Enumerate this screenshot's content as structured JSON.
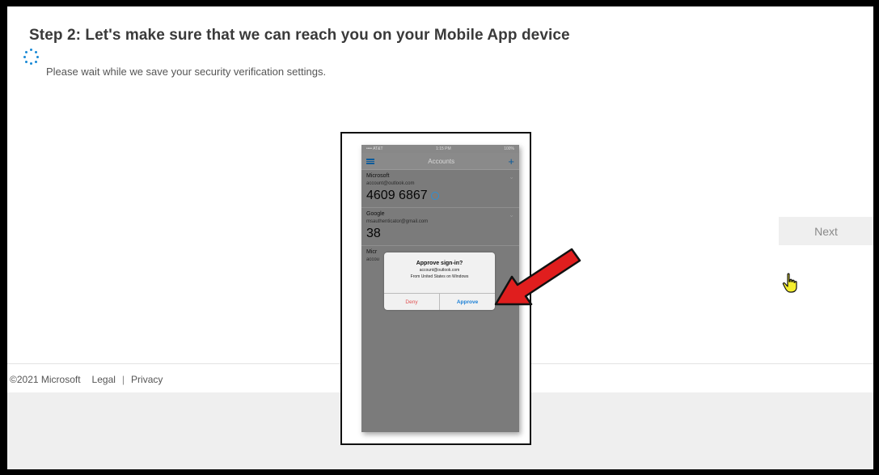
{
  "page": {
    "step_title": "Step 2: Let's make sure that we can reach you on your Mobile App device",
    "wait_text": "Please wait while we save your security verification settings.",
    "spinner_icon": "loading-spinner-icon"
  },
  "actions": {
    "next_label": "Next",
    "cursor_icon": "hand-pointer-icon"
  },
  "footer": {
    "copyright": "©2021 Microsoft",
    "legal": "Legal",
    "separator": "|",
    "privacy": "Privacy"
  },
  "phone": {
    "status_carrier": "•••• AT&T",
    "status_time": "1:15 PM",
    "status_battery": "100%",
    "header_title": "Accounts",
    "menu_icon": "hamburger-menu-icon",
    "add_icon": "plus-icon",
    "accounts": [
      {
        "name": "Microsoft",
        "email": "account@outlook.com",
        "code": "4609 6867"
      },
      {
        "name": "Google",
        "email": "msauthenticator@gmail.com",
        "code": "38"
      },
      {
        "name": "Micr",
        "email": "accou",
        "code": ""
      }
    ],
    "dialog": {
      "title": "Approve sign-in?",
      "account": "account@outlook.com",
      "location": "From United States on Windows",
      "deny": "Deny",
      "approve": "Approve"
    }
  },
  "annotation": {
    "arrow_icon": "red-arrow-icon",
    "arrow_color": "#e01e1e"
  },
  "colors": {
    "accent": "#1a8ad6",
    "title_text": "#3a3a3a",
    "button_bg": "#efefef"
  }
}
